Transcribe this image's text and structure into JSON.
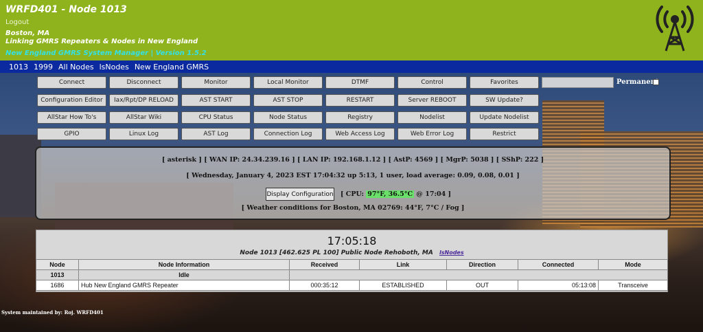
{
  "header": {
    "title": "WRFD401 - Node 1013",
    "logout": "Logout",
    "location": "Boston, MA",
    "tagline": "Linking GMRS Repeaters & Nodes in New England",
    "version": "New England GMRS System Manager | Version 1.5.2",
    "bg_color": "#8fb31c"
  },
  "nav": {
    "items": [
      "1013",
      "1999",
      "All Nodes",
      "lsNodes",
      "New England GMRS"
    ],
    "bg_color": "#0b2aa0"
  },
  "buttons": {
    "row1": [
      "Connect",
      "Disconnect",
      "Monitor",
      "Local Monitor",
      "DTMF",
      "Control",
      "Favorites"
    ],
    "row2": [
      "Configuration Editor",
      "Iax/Rpt/DP RELOAD",
      "AST START",
      "AST STOP",
      "RESTART",
      "Server REBOOT",
      "SW Update?"
    ],
    "row3": [
      "AllStar How To's",
      "AllStar Wiki",
      "CPU Status",
      "Node Status",
      "Registry",
      "Nodelist",
      "Update Nodelist"
    ],
    "row4": [
      "GPIO",
      "Linux Log",
      "AST Log",
      "Connection Log",
      "Web Access Log",
      "Web Error Log",
      "Restrict"
    ],
    "permanent_label": "Permanent"
  },
  "info": {
    "line1": "[ asterisk ] [ WAN IP: 24.34.239.16 ] [ LAN IP: 192.168.1.12 ] [ AstP: 4569 ] [ MgrP: 5038 ] [ SShP: 222 ]",
    "line2": "[ Wednesday, January 4, 2023 EST 17:04:32 up 5:13, 1 user, load average: 0.09, 0.08, 0.01 ]",
    "display_config": "Display Configuration",
    "cpu_prefix": "[ CPU:",
    "cpu_temp": "97°F, 36.5°C",
    "cpu_suffix": "@ 17:04 ]",
    "weather": "[ Weather conditions for Boston, MA 02769:  44°F, 7°C / Fog  ]"
  },
  "node_table": {
    "clock": "17:05:18",
    "subtitle": "Node 1013 [462.625 PL 100] Public Node Rehoboth, MA",
    "subtitle_link": "lsNodes",
    "columns": [
      "Node",
      "Node Information",
      "Received",
      "Link",
      "Direction",
      "Connected",
      "Mode"
    ],
    "idle_row": {
      "node": "1013",
      "status": "Idle"
    },
    "rows": [
      {
        "node": "1686",
        "info": "Hub New England GMRS Repeater",
        "received": "000:35:12",
        "link": "ESTABLISHED",
        "direction": "OUT",
        "connected": "05:13:08",
        "mode": "Transceive"
      }
    ]
  },
  "footer": {
    "maintained": "System maintained by:   Roj.   WRFD401"
  }
}
